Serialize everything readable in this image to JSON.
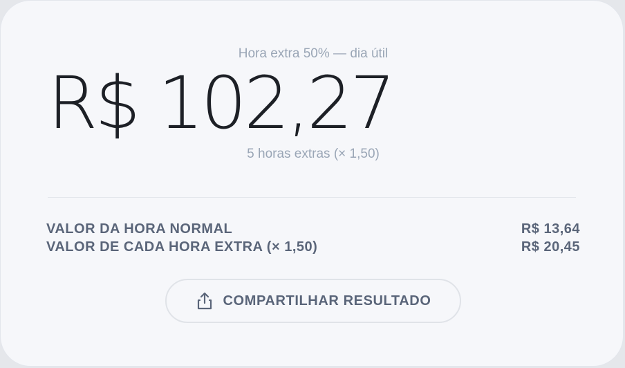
{
  "result": {
    "subtitle": "Hora extra 50% — dia útil",
    "amount": "R$ 102,27",
    "hours_note": "5 horas extras (× 1,50)"
  },
  "breakdown": {
    "rows": [
      {
        "label": "VALOR DA HORA NORMAL",
        "value": "R$ 13,64"
      },
      {
        "label": "VALOR DE CADA HORA EXTRA (× 1,50)",
        "value": "R$ 20,45"
      }
    ]
  },
  "share_button": {
    "icon": "share-icon",
    "label": "COMPARTILHAR RESULTADO"
  },
  "colors": {
    "card_background": "#f6f7fa",
    "amount_text": "#1d2026",
    "muted_text": "#9aa6b6",
    "label_text": "#5a6579"
  }
}
